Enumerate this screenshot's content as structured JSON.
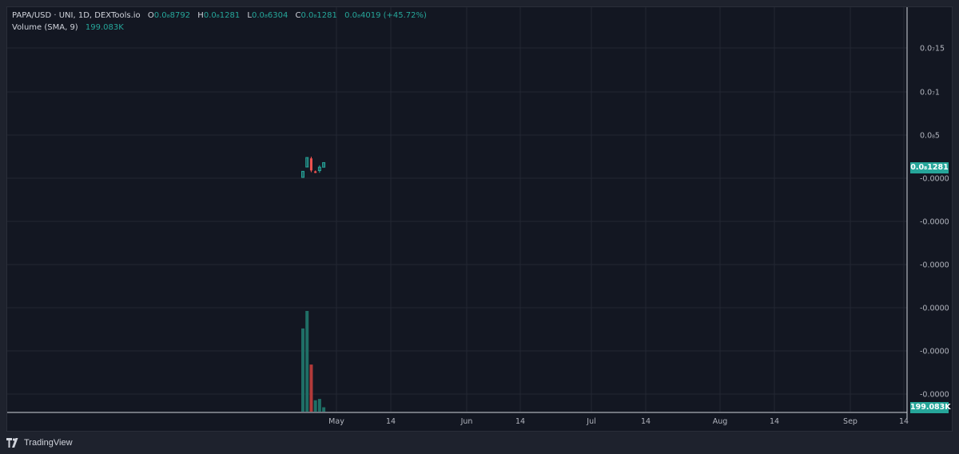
{
  "legend": {
    "symbol": "PAPA/USD · UNI, 1D, DEXTools.io",
    "o_label": "O",
    "o_value": "0.0₈8792",
    "h_label": "H",
    "h_value": "0.0₈1281",
    "l_label": "L",
    "l_value": "0.0₈6304",
    "c_label": "C",
    "c_value": "0.0₈1281",
    "change": "0.0₈4019 (+45.72%)",
    "volume_label": "Volume (SMA, 9)",
    "volume_value": "199.083K"
  },
  "price_axis_labels": [
    "0.0₇15",
    "0.0₇1",
    "0.0₈5",
    "-0.0000",
    "-0.0000",
    "-0.0000",
    "-0.0000",
    "-0.0000",
    "-0.0000"
  ],
  "current_price_tag": "0.0₈1281",
  "current_volume_tag": "199.083K",
  "time_axis_labels": [
    "May",
    "14",
    "Jun",
    "14",
    "Jul",
    "14",
    "Aug",
    "14",
    "Sep",
    "14"
  ],
  "branding": "TradingView",
  "colors": {
    "up": "#26a69a",
    "down": "#ef5350",
    "up_volume": "#1f6f66",
    "down_volume": "#b23a3a",
    "background": "#131722"
  },
  "chart_data": {
    "type": "candlestick",
    "price_ylim": [
      -3.5e-08,
      1.9e-07
    ],
    "candles": [
      {
        "date": "2024-04-22",
        "open": 1e-09,
        "high": 8e-09,
        "low": 1e-09,
        "close": 8e-09
      },
      {
        "date": "2024-04-23",
        "open": 1.3e-08,
        "high": 2.4e-08,
        "low": 1.3e-08,
        "close": 2.4e-08
      },
      {
        "date": "2024-04-24",
        "open": 2.3e-08,
        "high": 2.5e-08,
        "low": 7e-09,
        "close": 9e-09
      },
      {
        "date": "2024-04-25",
        "open": 8e-09,
        "high": 9e-09,
        "low": 6e-09,
        "close": 7e-09
      },
      {
        "date": "2024-04-26",
        "open": 8.8e-09,
        "high": 1.5e-08,
        "low": 6.3e-09,
        "close": 1.28e-08
      },
      {
        "date": "2024-04-27",
        "open": 1.28e-08,
        "high": 1.81e-08,
        "low": 1.28e-08,
        "close": 1.81e-08
      }
    ],
    "volume": [
      {
        "date": "2024-04-22",
        "value": 3800000,
        "direction": "up"
      },
      {
        "date": "2024-04-23",
        "value": 4600000,
        "direction": "up"
      },
      {
        "date": "2024-04-24",
        "value": 2150000,
        "direction": "down"
      },
      {
        "date": "2024-04-25",
        "value": 520000,
        "direction": "up"
      },
      {
        "date": "2024-04-26",
        "value": 580000,
        "direction": "up"
      },
      {
        "date": "2024-04-27",
        "value": 199083,
        "direction": "up"
      }
    ]
  }
}
